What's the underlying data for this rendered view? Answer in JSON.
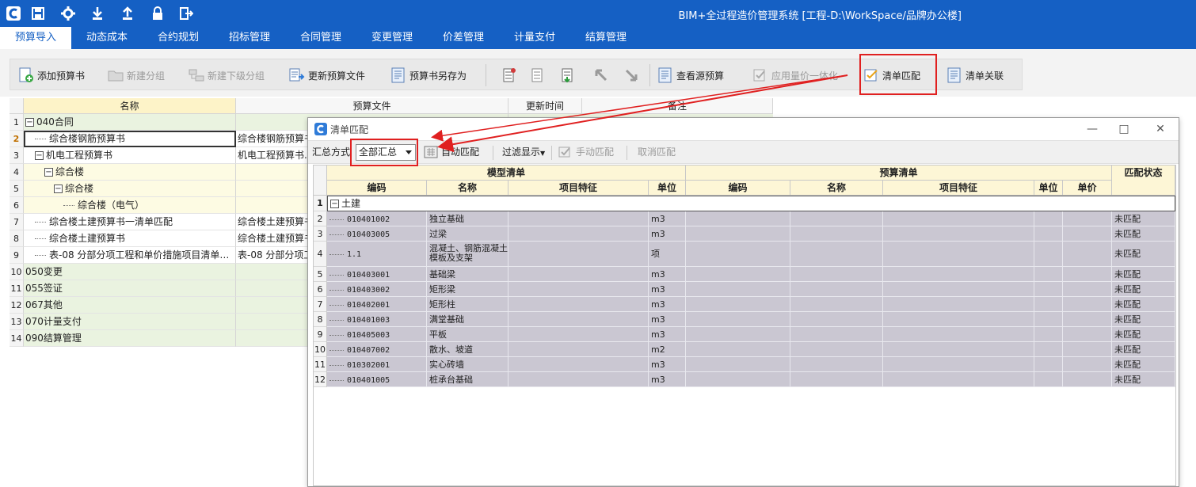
{
  "app": {
    "title": "BIM+全过程造价管理系统 [工程-D:\\WorkSpace/品牌办公楼]",
    "quick_icons": [
      "app-logo-icon",
      "save-icon",
      "gear-icon",
      "download-icon",
      "upload-icon",
      "lock-icon",
      "exit-icon"
    ]
  },
  "menu": {
    "tabs": [
      "预算导入",
      "动态成本",
      "合约规划",
      "招标管理",
      "合同管理",
      "变更管理",
      "价差管理",
      "计量支付",
      "结算管理"
    ],
    "active": "预算导入"
  },
  "ribbon": {
    "buttons": [
      {
        "label": "添加预算书",
        "icon": "add-budget-icon",
        "disabled": false
      },
      {
        "label": "新建分组",
        "icon": "folder-icon",
        "disabled": true
      },
      {
        "label": "新建下级分组",
        "icon": "subgroup-icon",
        "disabled": true
      },
      {
        "label": "更新预算文件",
        "icon": "update-file-icon",
        "disabled": false
      },
      {
        "label": "预算书另存为",
        "icon": "save-as-icon",
        "disabled": false
      },
      {
        "label": "查看源预算",
        "icon": "view-source-icon",
        "disabled": false
      },
      {
        "label": "应用量价一体化",
        "icon": "apply-icon",
        "disabled": true
      },
      {
        "label": "清单匹配",
        "icon": "bill-match-icon",
        "disabled": false
      },
      {
        "label": "清单关联",
        "icon": "bill-link-icon",
        "disabled": false
      }
    ]
  },
  "left_table": {
    "headers": [
      "名称",
      "预算文件",
      "更新时间",
      "备注"
    ],
    "rows": [
      {
        "num": "1",
        "name": "040合同",
        "file": "",
        "level": 0,
        "toggle": "−"
      },
      {
        "num": "2",
        "name": "综合楼钢筋预算书",
        "file": "综合楼钢筋预算书",
        "level": 1,
        "toggle": ""
      },
      {
        "num": "3",
        "name": "机电工程预算书",
        "file": "机电工程预算书.",
        "level": 1,
        "toggle": "−"
      },
      {
        "num": "4",
        "name": "综合楼",
        "file": "",
        "level": 2,
        "toggle": "−"
      },
      {
        "num": "5",
        "name": "综合楼",
        "file": "",
        "level": 3,
        "toggle": "−"
      },
      {
        "num": "6",
        "name": "综合楼（电气）",
        "file": "",
        "level": 4,
        "toggle": ""
      },
      {
        "num": "7",
        "name": "综合楼土建预算书一清单匹配",
        "file": "综合楼土建预算书",
        "level": 1,
        "toggle": ""
      },
      {
        "num": "8",
        "name": "综合楼土建预算书",
        "file": "综合楼土建预算书",
        "level": 1,
        "toggle": ""
      },
      {
        "num": "9",
        "name": "表-08 分部分项工程和单价措施项目清单…",
        "file": "表-08 分部分项工",
        "level": 1,
        "toggle": ""
      },
      {
        "num": "10",
        "name": "050变更",
        "file": "",
        "level": 0,
        "toggle": ""
      },
      {
        "num": "11",
        "name": "055签证",
        "file": "",
        "level": 0,
        "toggle": ""
      },
      {
        "num": "12",
        "name": "067其他",
        "file": "",
        "level": 0,
        "toggle": ""
      },
      {
        "num": "13",
        "name": "070计量支付",
        "file": "",
        "level": 0,
        "toggle": ""
      },
      {
        "num": "14",
        "name": "090结算管理",
        "file": "",
        "level": 0,
        "toggle": ""
      }
    ]
  },
  "dialog": {
    "title": "清单匹配",
    "toolbar": {
      "summary_label": "汇总方式",
      "summary_value": "全部汇总",
      "auto_match": "自动匹配",
      "filter": "过滤显示",
      "manual_match": "手动匹配",
      "cancel_match": "取消匹配"
    },
    "header_groups": [
      "模型清单",
      "预算清单",
      "匹配状态"
    ],
    "columns": [
      "编码",
      "名称",
      "项目特征",
      "单位",
      "编码",
      "名称",
      "项目特征",
      "单位",
      "单价"
    ],
    "group_row": {
      "num": "1",
      "label": "土建"
    },
    "rows": [
      {
        "num": "2",
        "code": "010401002",
        "name": "独立基础",
        "unit": "m3",
        "status": "未匹配"
      },
      {
        "num": "3",
        "code": "010403005",
        "name": "过梁",
        "unit": "m3",
        "status": "未匹配"
      },
      {
        "num": "4",
        "code": "1.1",
        "name": "混凝土、钢筋混凝土模板及支架",
        "unit": "项",
        "status": "未匹配"
      },
      {
        "num": "5",
        "code": "010403001",
        "name": "基础梁",
        "unit": "m3",
        "status": "未匹配"
      },
      {
        "num": "6",
        "code": "010403002",
        "name": "矩形梁",
        "unit": "m3",
        "status": "未匹配"
      },
      {
        "num": "7",
        "code": "010402001",
        "name": "矩形柱",
        "unit": "m3",
        "status": "未匹配"
      },
      {
        "num": "8",
        "code": "010401003",
        "name": "满堂基础",
        "unit": "m3",
        "status": "未匹配"
      },
      {
        "num": "9",
        "code": "010405003",
        "name": "平板",
        "unit": "m3",
        "status": "未匹配"
      },
      {
        "num": "10",
        "code": "010407002",
        "name": "散水、坡道",
        "unit": "m2",
        "status": "未匹配"
      },
      {
        "num": "11",
        "code": "010302001",
        "name": "实心砖墙",
        "unit": "m3",
        "status": "未匹配"
      },
      {
        "num": "12",
        "code": "010401005",
        "name": "桩承台基础",
        "unit": "m3",
        "status": "未匹配"
      }
    ]
  },
  "colors": {
    "titlebar": "#1560c4",
    "annotation_red": "#e02020",
    "grid_row_bg": "#cac7d2",
    "header_bg": "#fdf6d6",
    "selected_row_bg": "#fdfbe3",
    "group_row_bg": "#eaf3e0"
  }
}
